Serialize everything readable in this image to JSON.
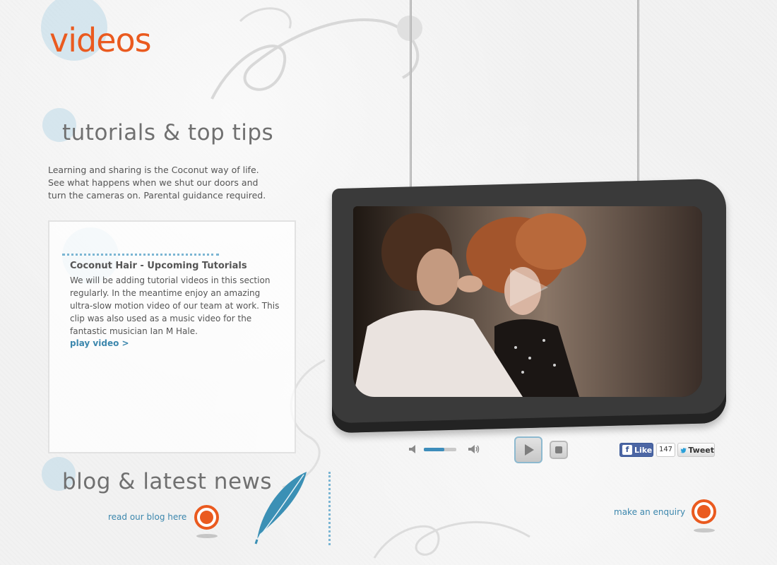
{
  "page": {
    "title": "videos"
  },
  "tutorials": {
    "heading": "tutorials & top tips",
    "intro": "Learning and sharing is the Coconut way of life. See what happens when we shut our doors and turn the cameras on. Parental guidance required."
  },
  "panel": {
    "title": "Coconut Hair - Upcoming Tutorials",
    "body": "We will be adding tutorial videos in this section regularly. In the meantime enjoy an amazing ultra-slow motion video of our team at work. This clip was also used as a music video for the fantastic musician Ian M Hale.",
    "link": "play video >"
  },
  "player": {
    "volume_level": 0.62
  },
  "social": {
    "fb_like_label": "Like",
    "fb_icon_label": "f",
    "fb_count": "147",
    "tweet_label": "Tweet"
  },
  "blog": {
    "heading": "blog & latest news",
    "link": "read our blog here"
  },
  "enquiry": {
    "link": "make an enquiry"
  },
  "colors": {
    "accent": "#ea5a1f",
    "link": "#3c87ad",
    "bubble": "#bcd9e8"
  },
  "icons": {
    "speaker_low": "speaker-low-icon",
    "speaker_high": "speaker-high-icon",
    "play": "play-icon",
    "stop": "stop-icon",
    "feather": "feather-icon",
    "arrow": "circular-arrow-icon"
  }
}
